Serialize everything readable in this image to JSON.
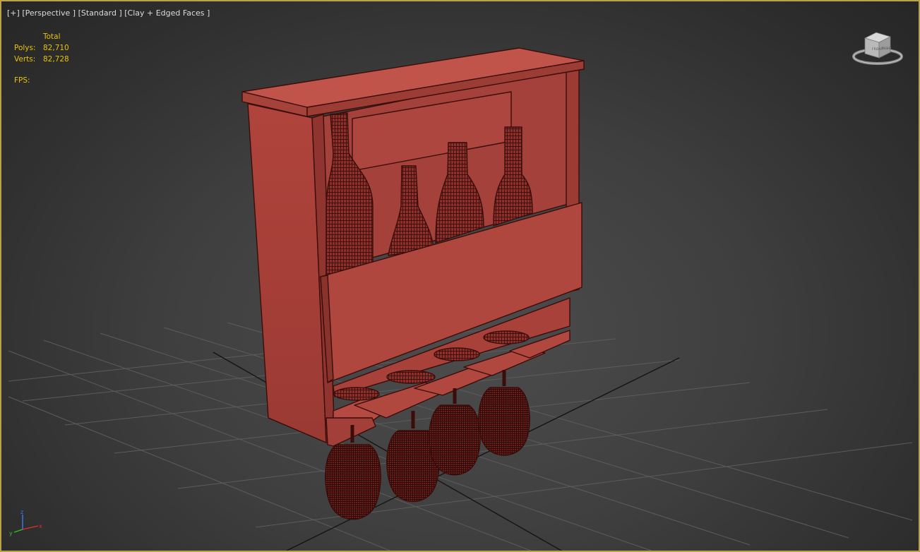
{
  "viewport": {
    "menu": {
      "plus": "[+]",
      "view": "[Perspective ]",
      "shading": "[Standard ]",
      "style": "[Clay + Edged Faces ]"
    },
    "stats": {
      "header": "Total",
      "polys_label": "Polys:",
      "polys_value": "82,710",
      "verts_label": "Verts:",
      "verts_value": "82,728",
      "fps_label": "FPS:"
    },
    "viewcube": {
      "top_label": "TOP",
      "front_label": "FRONT",
      "right_label": "RIGHT"
    },
    "axis": {
      "z_label": "z",
      "x_label": "x",
      "y_label": "y"
    },
    "colors": {
      "frame_border": "#b8a24a",
      "stats_text": "#e8c400",
      "model_clay": "#b5463e",
      "model_edge": "#3a0d0a",
      "grid_line": "#5a5a5a"
    },
    "model": {
      "icon": "wine-rack-model"
    }
  }
}
